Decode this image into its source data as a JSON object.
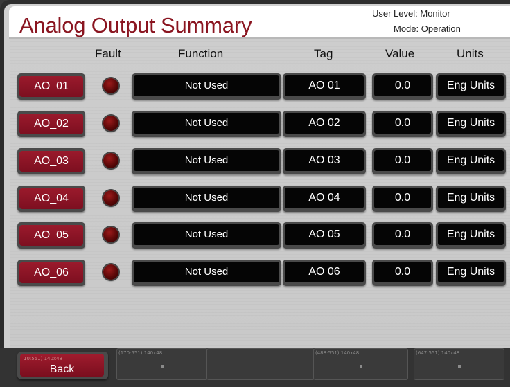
{
  "header": {
    "title": "Analog Output Summary",
    "user_level": "User Level: Monitor",
    "mode": "Mode: Operation"
  },
  "columns": {
    "fault": "Fault",
    "function": "Function",
    "tag": "Tag",
    "value": "Value",
    "units": "Units"
  },
  "rows": [
    {
      "button": "AO_01",
      "function": "Not Used",
      "tag": "AO 01",
      "value": "0.0",
      "units": "Eng Units"
    },
    {
      "button": "AO_02",
      "function": "Not Used",
      "tag": "AO 02",
      "value": "0.0",
      "units": "Eng Units"
    },
    {
      "button": "AO_03",
      "function": "Not Used",
      "tag": "AO 03",
      "value": "0.0",
      "units": "Eng Units"
    },
    {
      "button": "AO_04",
      "function": "Not Used",
      "tag": "AO 04",
      "value": "0.0",
      "units": "Eng Units"
    },
    {
      "button": "AO_05",
      "function": "Not Used",
      "tag": "AO 05",
      "value": "0.0",
      "units": "Eng Units"
    },
    {
      "button": "AO_06",
      "function": "Not Used",
      "tag": "AO 06",
      "value": "0.0",
      "units": "Eng Units"
    }
  ],
  "footer": {
    "back_label": "Back",
    "back_caption": "10:551) 140x48",
    "slot_captions": [
      "(170:551) 140x48",
      "(488:551) 140x48",
      "(647:551) 140x48"
    ]
  },
  "colors": {
    "accent": "#8a1520",
    "button": "#8c1426",
    "fault_led_off": "#5a0808",
    "display_bg": "#050505"
  }
}
